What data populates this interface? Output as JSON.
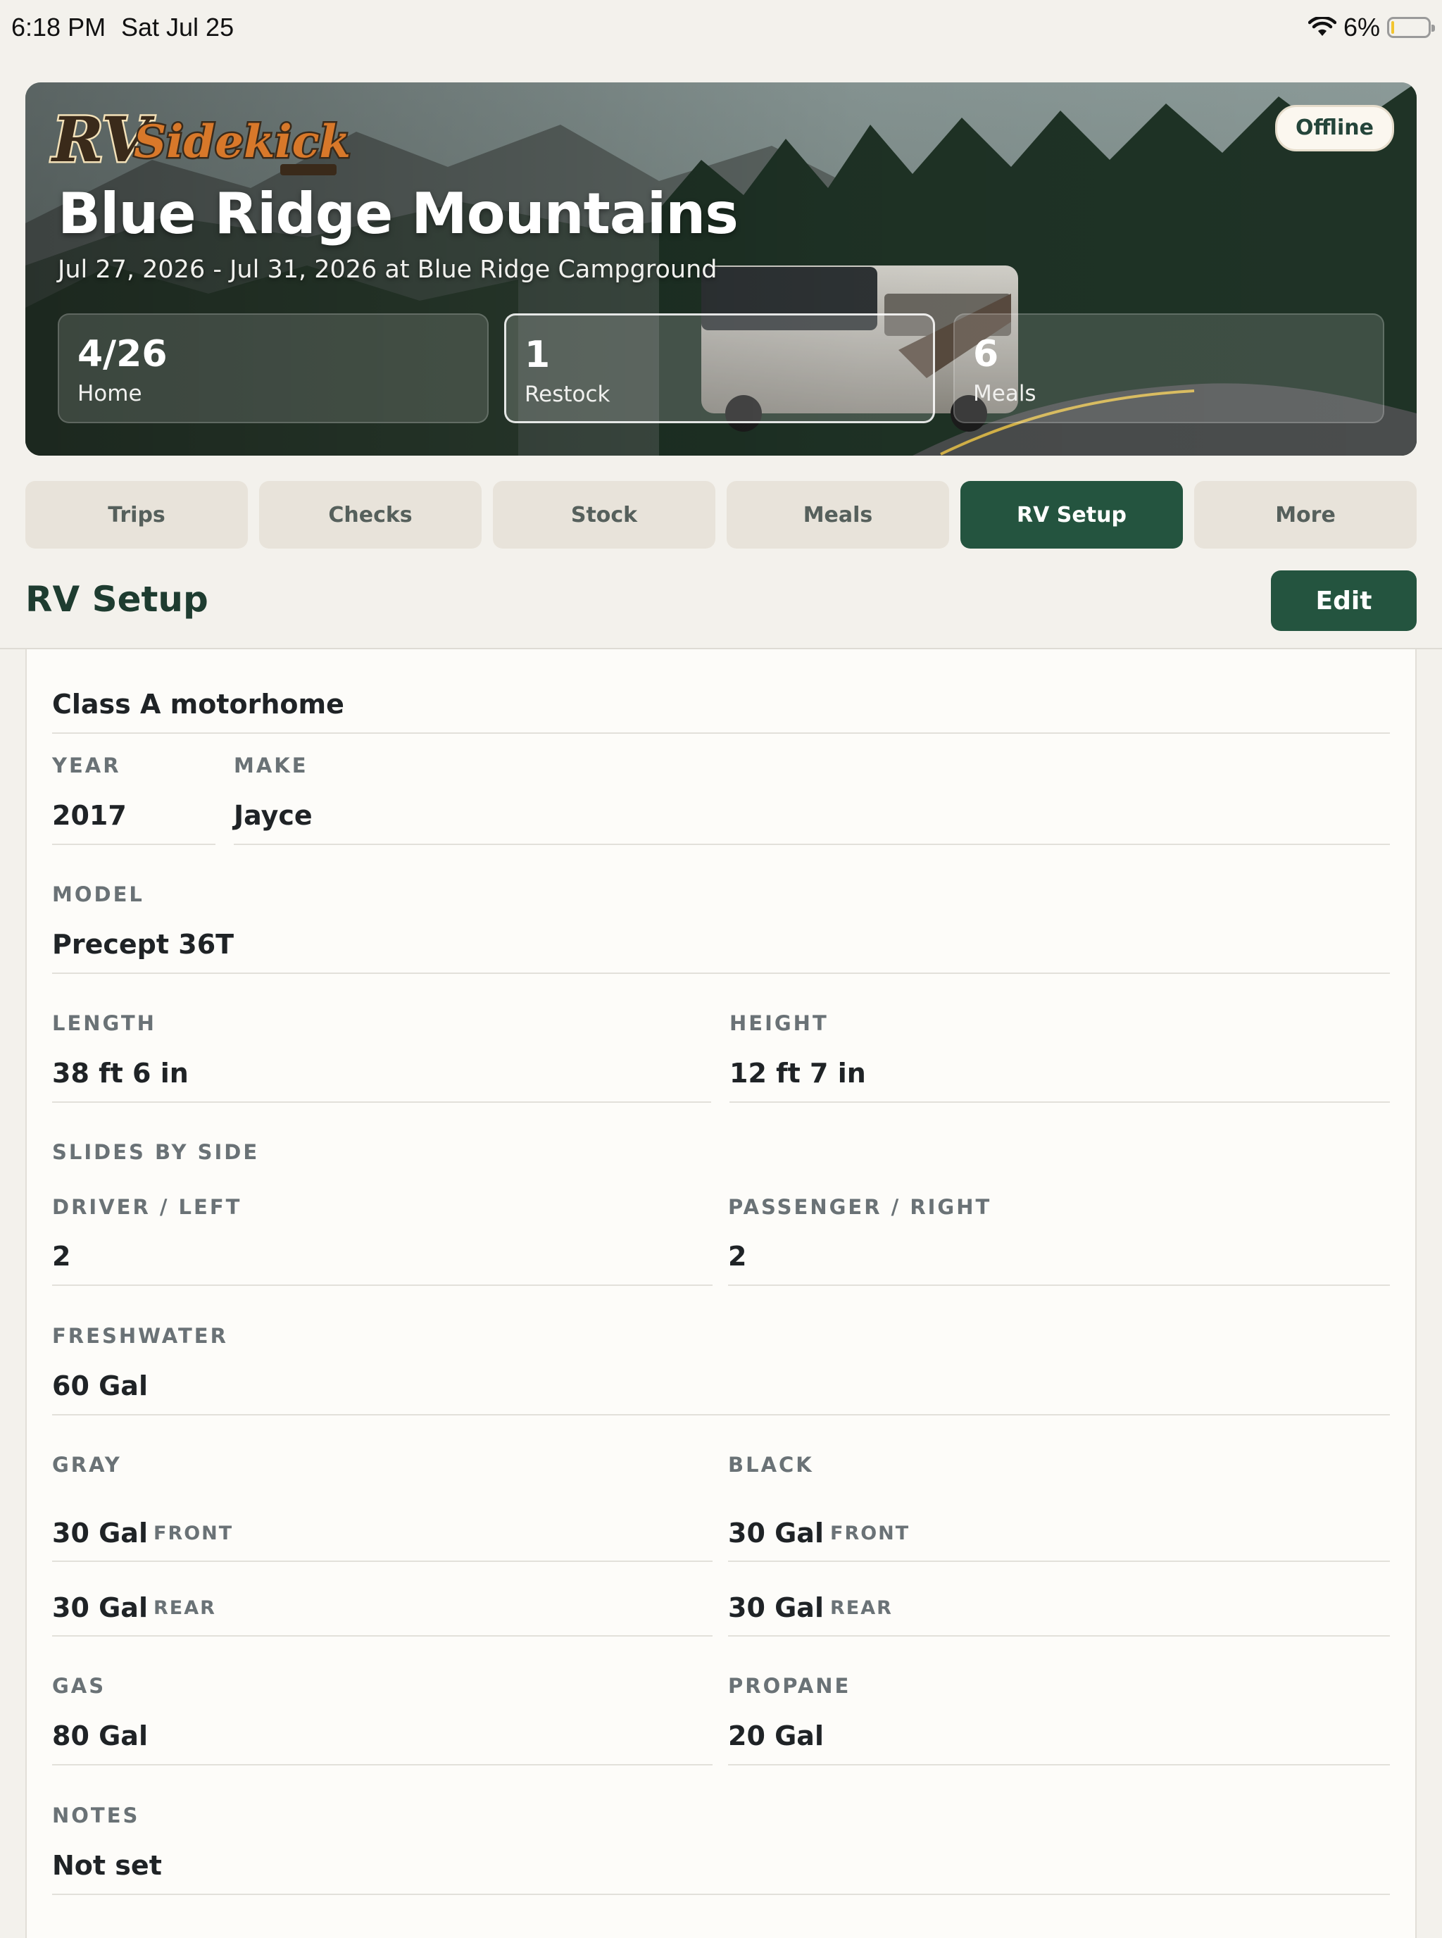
{
  "status_bar": {
    "time": "6:18 PM",
    "date": "Sat Jul 25",
    "battery_percent": "6%",
    "battery_level": 0.06,
    "wifi_icon": "wifi-icon"
  },
  "hero": {
    "logo": "RVSidekick",
    "offline_label": "Offline",
    "title": "Blue Ridge Mountains",
    "subtitle": "Jul 27, 2026 - Jul 31, 2026 at Blue Ridge Campground",
    "stats": [
      {
        "value": "4/26",
        "label": "Home"
      },
      {
        "value": "1",
        "label": "Restock"
      },
      {
        "value": "6",
        "label": "Meals"
      }
    ]
  },
  "tabs": [
    {
      "label": "Trips"
    },
    {
      "label": "Checks"
    },
    {
      "label": "Stock"
    },
    {
      "label": "Meals"
    },
    {
      "label": "RV Setup",
      "active": true
    },
    {
      "label": "More"
    }
  ],
  "section": {
    "title": "RV Setup",
    "edit_label": "Edit"
  },
  "rv": {
    "class": "Class A motorhome",
    "year_label": "YEAR",
    "year": "2017",
    "make_label": "MAKE",
    "make": "Jayce",
    "model_label": "MODEL",
    "model": "Precept 36T",
    "length_label": "LENGTH",
    "length": "38 ft 6 in",
    "height_label": "HEIGHT",
    "height": "12 ft 7 in",
    "slides_label": "SLIDES BY SIDE",
    "driver_label": "DRIVER / LEFT",
    "driver": "2",
    "passenger_label": "PASSENGER / RIGHT",
    "passenger": "2",
    "freshwater_label": "FRESHWATER",
    "freshwater": "60 Gal",
    "gray_label": "GRAY",
    "gray_front": "30 Gal",
    "gray_rear": "30 Gal",
    "black_label": "BLACK",
    "black_front": "30 Gal",
    "black_rear": "30 Gal",
    "front_tag": "FRONT",
    "rear_tag": "REAR",
    "gas_label": "GAS",
    "gas": "80 Gal",
    "propane_label": "PROPANE",
    "propane": "20 Gal",
    "notes_label": "NOTES",
    "notes": "Not set"
  }
}
